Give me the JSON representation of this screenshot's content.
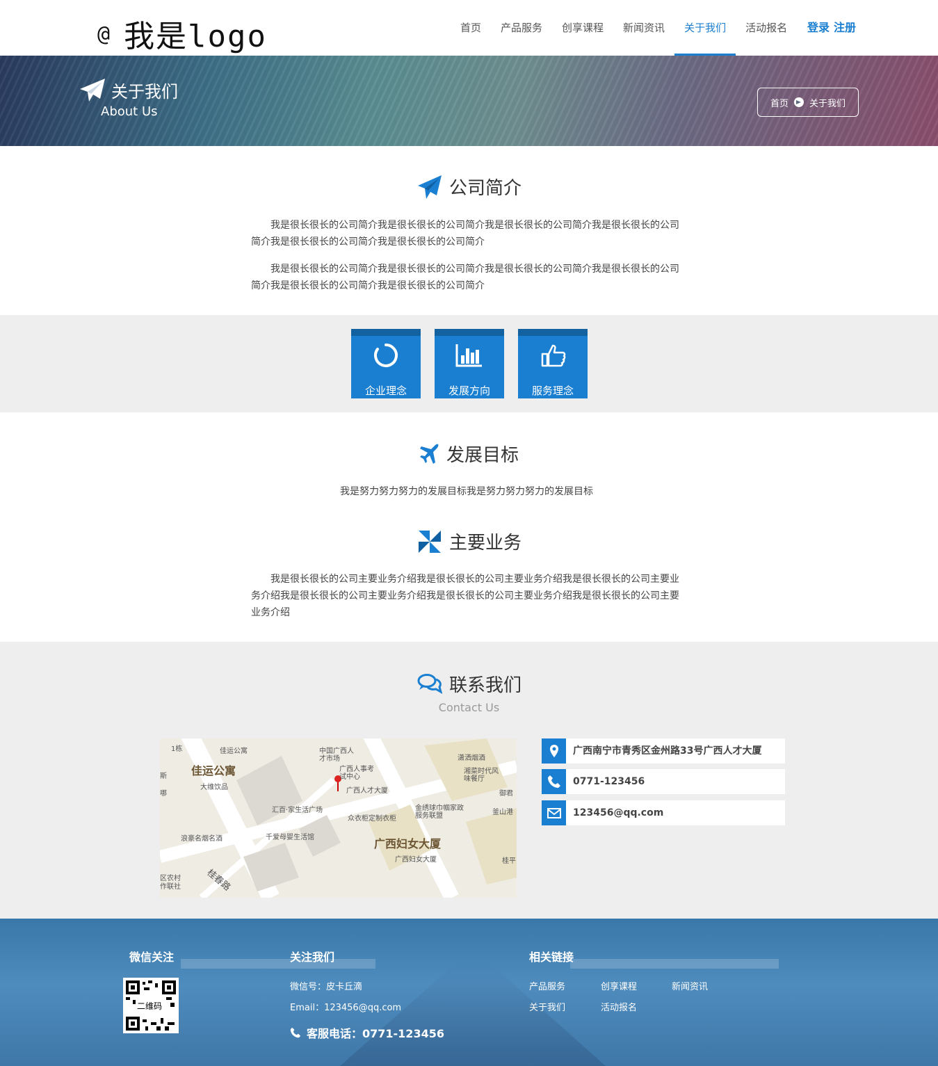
{
  "header": {
    "logo_symbol": "@",
    "logo_text": "我是logo",
    "nav": [
      "首页",
      "产品服务",
      "创享课程",
      "新闻资讯",
      "关于我们",
      "活动报名"
    ],
    "nav_active": "关于我们",
    "login": "登录",
    "register": "注册"
  },
  "banner": {
    "title": "关于我们",
    "subtitle": "About Us",
    "crumb_home": "首页",
    "crumb_current": "关于我们"
  },
  "intro": {
    "heading": "公司简介",
    "p1": "我是很长很长的公司简介我是很长很长的公司简介我是很长很长的公司简介我是很长很长的公司简介我是很长很长的公司简介我是很长很长的公司简介",
    "p2": "我是很长很长的公司简介我是很长很长的公司简介我是很长很长的公司简介我是很长很长的公司简介我是很长很长的公司简介我是很长很长的公司简介"
  },
  "values": [
    {
      "label": "企业理念",
      "icon": "circle-notch-icon"
    },
    {
      "label": "发展方向",
      "icon": "bar-chart-icon"
    },
    {
      "label": "服务理念",
      "icon": "thumbs-up-icon"
    }
  ],
  "goal": {
    "heading": "发展目标",
    "text": "我是努力努力努力的发展目标我是努力努力努力的发展目标"
  },
  "business": {
    "heading": "主要业务",
    "text": "我是很长很长的公司主要业务介绍我是很长很长的公司主要业务介绍我是很长很长的公司主要业务介绍我是很长很长的公司主要业务介绍我是很长很长的公司主要业务介绍我是很长很长的公司主要业务介绍"
  },
  "contact": {
    "heading": "联系我们",
    "subtitle": "Contact Us",
    "address": "广西南宁市青秀区金州路33号广西人才大厦",
    "phone": "0771-123456",
    "email": "123456@qq.com",
    "map_labels": {
      "l1": "1栋",
      "l2": "佳运公寓",
      "l3": "佳运公寓",
      "l4": "大维饮品",
      "l5": "中国广西人才市场",
      "l6": "广西人事考试中心",
      "l7": "广西人才大厦",
      "l8": "潇洒烟酒",
      "l9": "湘菜时代风味餐厅",
      "l10": "御君",
      "l11": "汇百·家生活广场",
      "l12": "众衣柜定制衣柜",
      "l13": "金绣球巾帼家政服务联盟",
      "l14": "釜山港",
      "l15": "浪豪名烟名酒",
      "l16": "千爱母婴生活馆",
      "l17": "广西妇女大厦",
      "l18": "广西妇女大厦",
      "l19": "桂平",
      "l20": "桂春路",
      "l21": "区农村作联社",
      "l22": "斯",
      "l23": "哪"
    }
  },
  "footer": {
    "wechat_heading": "微信关注",
    "qr_label": "二维码",
    "follow_heading": "关注我们",
    "wechat_id": "微信号：皮卡丘滴",
    "email_line": "Email：123456@qq.com",
    "service_phone": "客服电话：0771-123456",
    "links_heading": "相关链接",
    "links": [
      "产品服务",
      "创享课程",
      "新闻资讯",
      "关于我们",
      "活动报名"
    ]
  },
  "colors": {
    "accent": "#1b7fd1",
    "accent_dark": "#13619f",
    "band": "#eeeeee",
    "footer": "#3f7db0"
  }
}
